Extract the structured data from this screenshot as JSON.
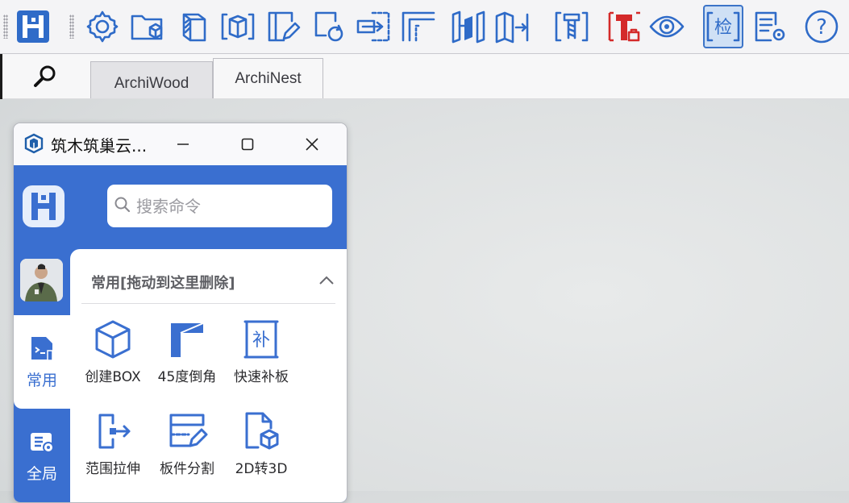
{
  "toolbar": {
    "items": [
      {
        "icon": "app-logo-icon"
      },
      {
        "icon": "gear-icon"
      },
      {
        "icon": "folder-box-icon"
      },
      {
        "icon": "hatched-box-icon"
      },
      {
        "icon": "box-bracket-icon"
      },
      {
        "icon": "panel-pencil-icon"
      },
      {
        "icon": "rotate-copy-icon"
      },
      {
        "icon": "move-arrow-icon"
      },
      {
        "icon": "corner-frame-icon"
      },
      {
        "icon": "panel-split-icon"
      },
      {
        "icon": "panel-arrows-icon"
      },
      {
        "icon": "screw-bracket-icon"
      },
      {
        "icon": "red-screw-icon"
      },
      {
        "icon": "eye-icon"
      },
      {
        "icon": "check-icon",
        "label": "检",
        "active": true
      },
      {
        "icon": "list-gear-icon"
      },
      {
        "icon": "help-icon",
        "label": "?"
      }
    ]
  },
  "tabs": [
    {
      "label": "ArchiWood"
    },
    {
      "label": "ArchiNest",
      "active": true
    }
  ],
  "panel": {
    "title": "筑木筑巢云...",
    "search_placeholder": "搜索命令",
    "sidebar": [
      {
        "label": "常用",
        "active": true
      },
      {
        "label": "全局"
      }
    ],
    "section_title": "常用[拖动到这里删除]",
    "commands": [
      {
        "label": "创建BOX"
      },
      {
        "label": "45度倒角"
      },
      {
        "label": "快速补板",
        "glyph": "补"
      },
      {
        "label": "范围拉伸"
      },
      {
        "label": "板件分割"
      },
      {
        "label": "2D转3D"
      }
    ]
  },
  "colors": {
    "accent": "#3a6fd0",
    "toolbar_icon": "#2f6bc8",
    "warning_icon": "#d42a2a"
  }
}
